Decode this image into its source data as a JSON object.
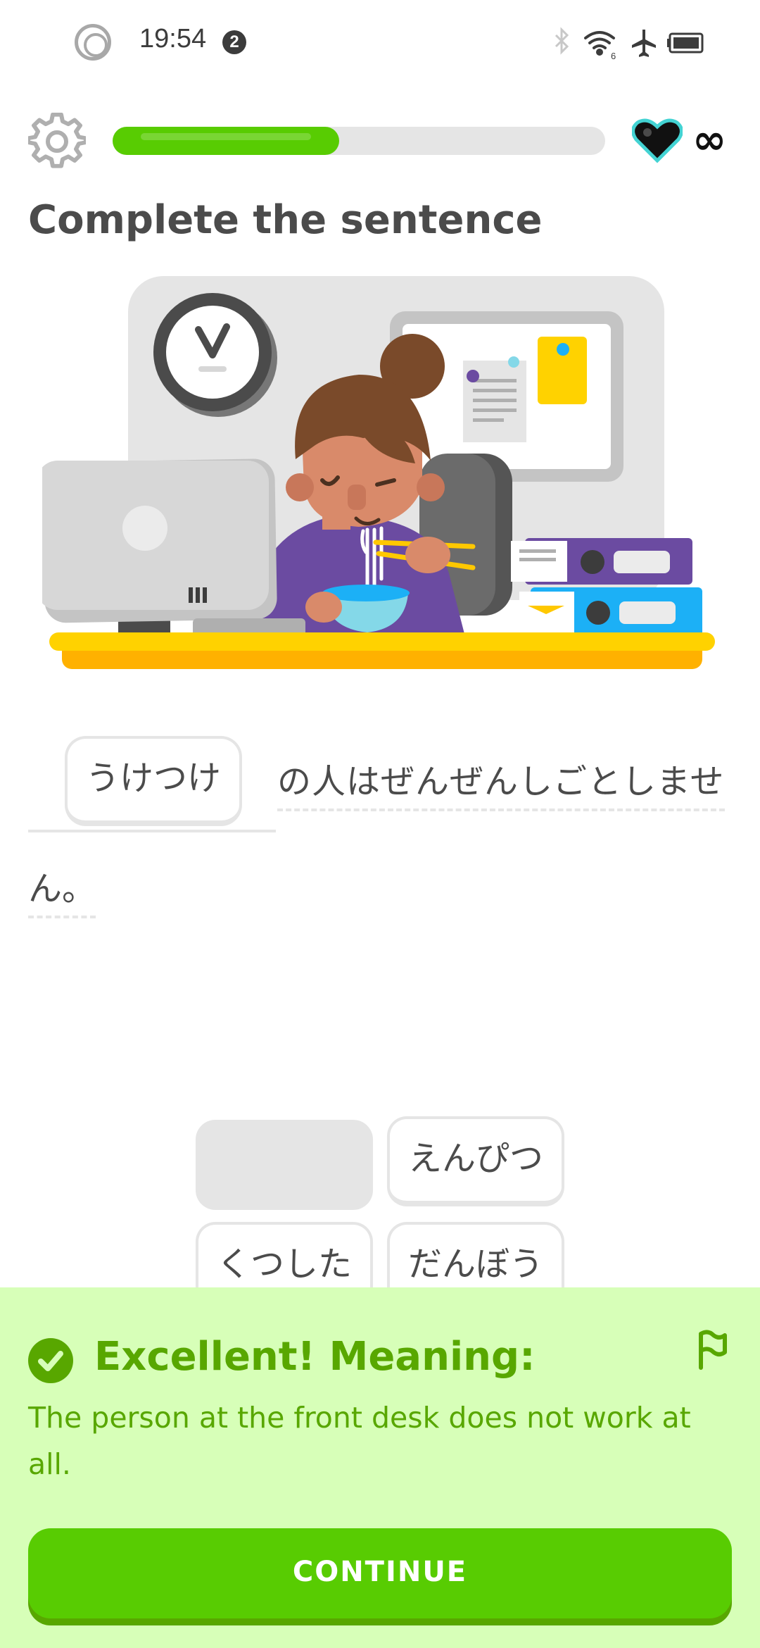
{
  "status_bar": {
    "time": "19:54",
    "notification_count": "2",
    "icons": [
      "bluetooth-icon",
      "wifi-icon",
      "airplane-mode-icon",
      "battery-icon"
    ]
  },
  "top_bar": {
    "settings_icon": "gear-icon",
    "progress_fraction": 0.46,
    "hearts_icon": "heart-icon",
    "hearts_value": "∞"
  },
  "title": "Complete the sentence",
  "sentence": {
    "answer": "うけつけ",
    "line1": "の人はぜんぜんしごとしませ",
    "line2": "ん。"
  },
  "word_bank": [
    {
      "label": "",
      "used": true
    },
    {
      "label": "えんぴつ",
      "used": false
    },
    {
      "label": "くつした",
      "used": false
    },
    {
      "label": "だんぼう",
      "used": false
    }
  ],
  "feedback": {
    "title": "Excellent! Meaning:",
    "text": "The person at the front desk does not work at all.",
    "continue_label": "CONTINUE"
  },
  "colors": {
    "accent_green": "#58cc02",
    "dark_green": "#58a700",
    "feedback_bg": "#d7ffb8"
  }
}
